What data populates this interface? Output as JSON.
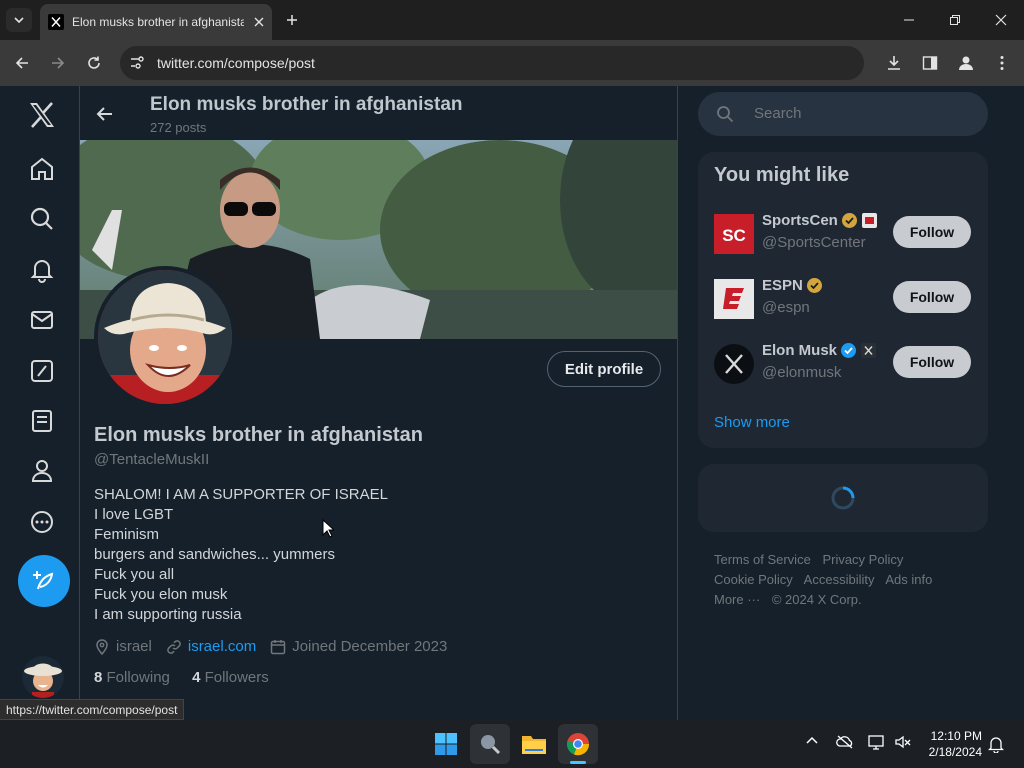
{
  "browser": {
    "tab_title": "Elon musks brother in afghanistan",
    "url": "twitter.com/compose/post",
    "status_url": "https://twitter.com/compose/post"
  },
  "header": {
    "name": "Elon musks brother in afghanistan",
    "posts": "272 posts"
  },
  "profile": {
    "display_name": "Elon musks brother in afghanistan",
    "handle": "@TentacleMuskII",
    "edit_label": "Edit profile",
    "bio": [
      "SHALOM! I AM A SUPPORTER OF ISRAEL",
      "I love LGBT",
      "Feminism",
      "burgers and sandwiches... yummers",
      "Fuck you all",
      "Fuck you elon musk",
      "I am supporting russia"
    ],
    "location": "israel",
    "website": "israel.com",
    "joined": "Joined December 2023",
    "following_count": "8",
    "following_label": "Following",
    "followers_count": "4",
    "followers_label": "Followers"
  },
  "search": {
    "placeholder": "Search"
  },
  "suggestions": {
    "title": "You might like",
    "items": [
      {
        "name": "SportsCen",
        "handle": "@SportsCenter",
        "badge": "gold",
        "follow": "Follow"
      },
      {
        "name": "ESPN",
        "handle": "@espn",
        "badge": "gold",
        "follow": "Follow"
      },
      {
        "name": "Elon Musk",
        "handle": "@elonmusk",
        "badge": "blue",
        "follow": "Follow"
      }
    ],
    "show_more": "Show more"
  },
  "footer": {
    "links": [
      "Terms of Service",
      "Privacy Policy",
      "Cookie Policy",
      "Accessibility",
      "Ads info",
      "More ···",
      "© 2024 X Corp."
    ]
  },
  "clock": {
    "time": "12:10 PM",
    "date": "2/18/2024"
  },
  "colors": {
    "accent": "#1d9bf0",
    "background": "#15202b",
    "verified_gold": "#d4a53d"
  }
}
